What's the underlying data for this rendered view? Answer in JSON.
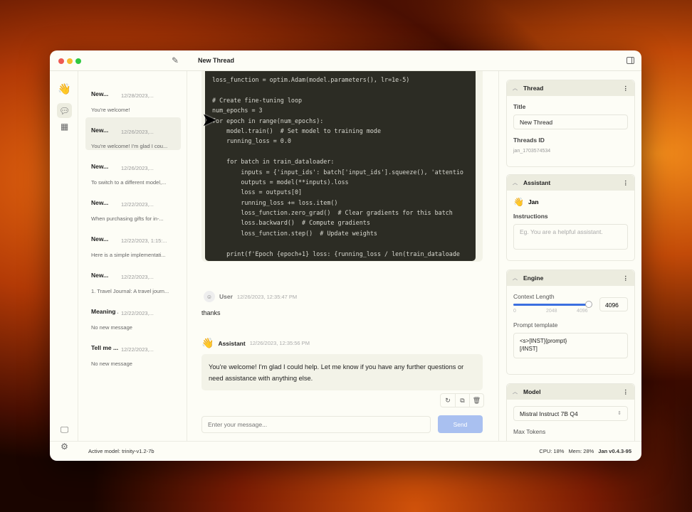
{
  "window": {
    "title": "New Thread"
  },
  "threads": [
    {
      "title": "New...",
      "date": "12/28/2023,...",
      "message": "You're welcome!"
    },
    {
      "title": "New...",
      "date": "12/26/2023,...",
      "message": "You're welcome! I'm glad I cou...",
      "active": true
    },
    {
      "title": "New...",
      "date": "12/26/2023,...",
      "message": "To switch to a different model,..."
    },
    {
      "title": "New...",
      "date": "12/22/2023,...",
      "message": "When purchasing gifts for in-..."
    },
    {
      "title": "New...",
      "date": "12/22/2023, 1:15:...",
      "message": "Here is a simple implementati..."
    },
    {
      "title": "New...",
      "date": "12/22/2023,...",
      "message": "1. Travel Journal: A travel journ..."
    },
    {
      "title": "Meaning ...",
      "date": "12/22/2023,...",
      "message": "No new message"
    },
    {
      "title": "Tell me ...",
      "date": "12/22/2023,...",
      "message": "No new message"
    }
  ],
  "code_lines": [
    "loss_function = optim.Adam(model.parameters(), lr=1e-5)",
    "",
    "# Create fine-tuning loop",
    "num_epochs = 3",
    "for epoch in range(num_epochs):",
    "    model.train()  # Set model to training mode",
    "    running_loss = 0.0",
    "",
    "    for batch in train_dataloader:",
    "        inputs = {'input_ids': batch['input_ids'].squeeze(), 'attentio",
    "        outputs = model(**inputs).loss",
    "        loss = outputs[0]",
    "        running_loss += loss.item()",
    "        loss_function.zero_grad()  # Clear gradients for this batch",
    "        loss.backward()  # Compute gradients",
    "        loss_function.step()  # Update weights",
    "",
    "    print(f'Epoch {epoch+1} loss: {running_loss / len(train_dataloade"
  ],
  "messages": [
    {
      "author": "User",
      "time": "12/26/2023, 12:35:47 PM",
      "text": "thanks"
    },
    {
      "author": "Assistant",
      "time": "12/26/2023, 12:35:56 PM",
      "text": "You're welcome! I'm glad I could help. Let me know if you have any further questions or need assistance with anything else."
    }
  ],
  "composer": {
    "placeholder": "Enter your message...",
    "send": "Send"
  },
  "panel": {
    "thread": {
      "header": "Thread",
      "title_label": "Title",
      "title_value": "New Thread",
      "id_label": "Threads ID",
      "id_value": "jan_1703574534"
    },
    "assistant": {
      "header": "Assistant",
      "name": "Jan",
      "instructions_label": "Instructions",
      "instructions_placeholder": "Eg. You are a helpful assistant."
    },
    "engine": {
      "header": "Engine",
      "context_label": "Context Length",
      "context_value": "4096",
      "slider_fraction": 1.0,
      "ticks": [
        "0",
        "2048",
        "4096"
      ],
      "prompt_label": "Prompt template",
      "prompt_value": "<s>[INST]{prompt}\n[/INST]"
    },
    "model": {
      "header": "Model",
      "selected": "Mistral Instruct 7B Q4",
      "max_tokens_label": "Max Tokens"
    }
  },
  "status": {
    "active_model": "Active model: trinity-v1.2-7b",
    "cpu": "CPU: 18%",
    "mem": "Mem: 28%",
    "version": "Jan v0.4.3-95"
  },
  "colors": {
    "accent": "#3b6fe0",
    "send_disabled": "#a9c0f0",
    "code_bg": "#2c2c24"
  }
}
